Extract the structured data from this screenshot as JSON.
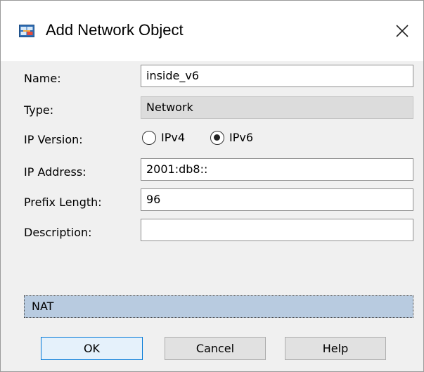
{
  "dialog": {
    "title": "Add Network Object",
    "app_icon": "network-object-icon",
    "close_icon": "close-icon"
  },
  "form": {
    "name": {
      "label": "Name:",
      "value": "inside_v6"
    },
    "type": {
      "label": "Type:",
      "value": "Network"
    },
    "ip_version": {
      "label": "IP Version:",
      "options": [
        "IPv4",
        "IPv6"
      ],
      "selected": "IPv6"
    },
    "ip_address": {
      "label": "IP Address:",
      "value": "2001:db8::"
    },
    "prefix_length": {
      "label": "Prefix Length:",
      "value": "96"
    },
    "description": {
      "label": "Description:",
      "value": ""
    }
  },
  "nat_section": {
    "label": "NAT"
  },
  "buttons": {
    "ok": "OK",
    "cancel": "Cancel",
    "help": "Help"
  },
  "colors": {
    "dialog_background": "#f0f0f0",
    "titlebar_background": "#ffffff",
    "readonly_field": "#dcdcdc",
    "nat_bar": "#b8cbe0",
    "default_button_border": "#0078d7"
  }
}
